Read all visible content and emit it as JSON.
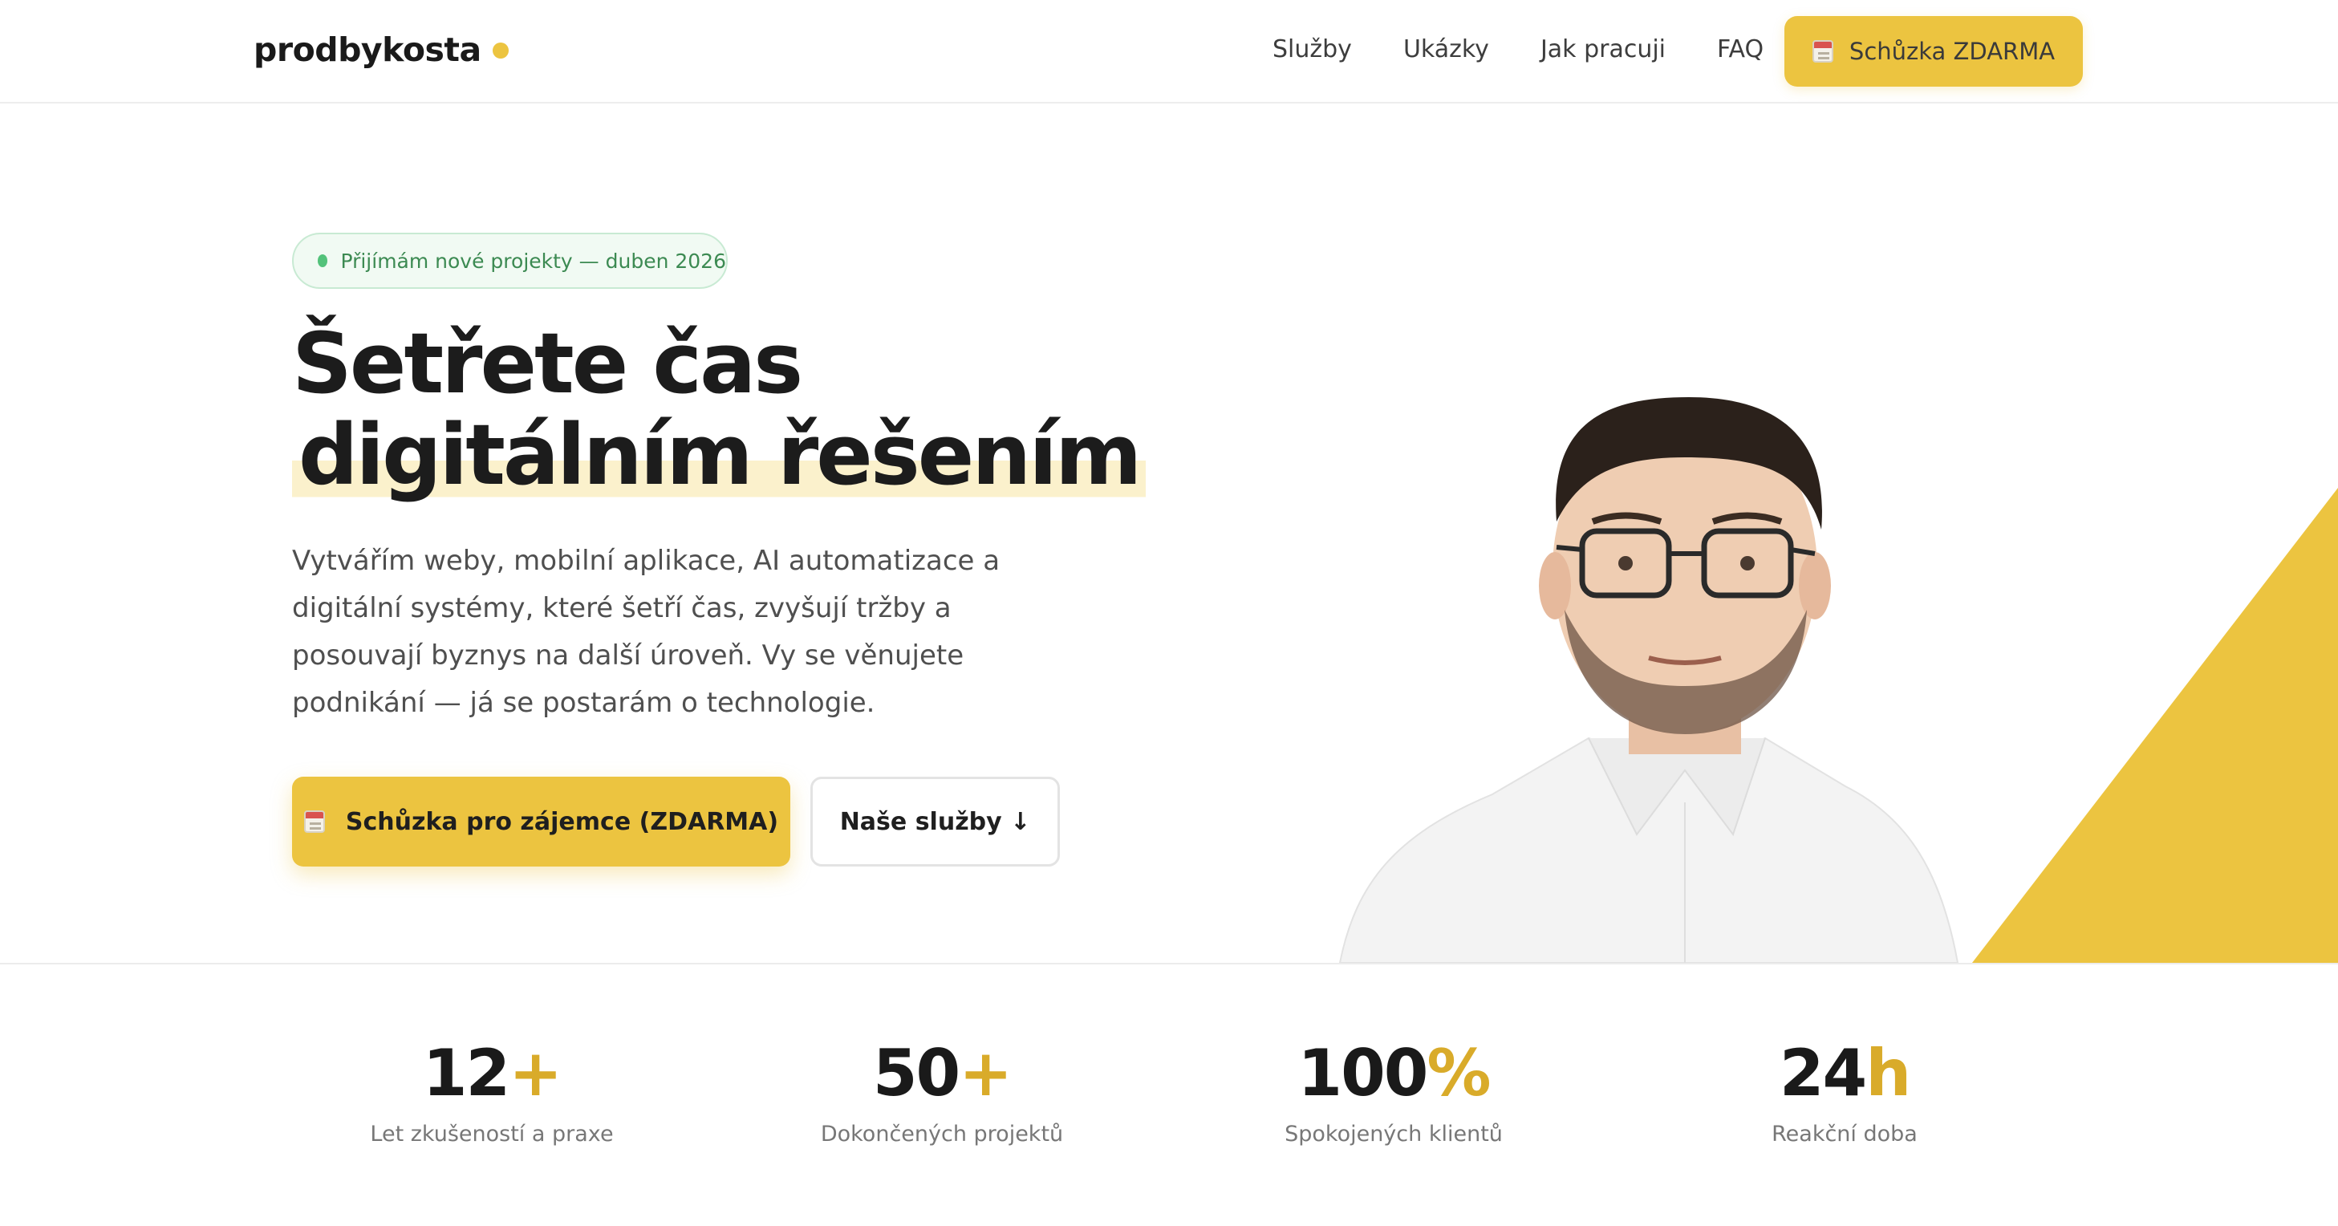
{
  "brand": {
    "name": "prodbykosta",
    "dot_color": "#ecc440"
  },
  "nav": {
    "items": [
      "Služby",
      "Ukázky",
      "Jak pracuji",
      "FAQ"
    ],
    "cta_label": "Schůzka ZDARMA",
    "cta_icon": "calendar-icon"
  },
  "hero": {
    "badge": "Přijímám nové projekty — duben 2026",
    "title_line1": "Šetřete čas",
    "title_line2": "digitálním řešením",
    "description": "Vytvářím weby, mobilní aplikace, AI automatizace a digitální systémy, které šetří čas, zvyšují tržby a posouvají byznys na další úroveň. Vy se věnujete podnikání — já se postarám o technologie.",
    "primary_button": "Schůzka pro zájemce (ZDARMA)",
    "secondary_button": "Naše služby ↓"
  },
  "stats": [
    {
      "value": "12",
      "suffix": "+",
      "label": "Let zkušeností a praxe"
    },
    {
      "value": "50",
      "suffix": "+",
      "label": "Dokončených projektů"
    },
    {
      "value": "100",
      "suffix": "%",
      "label": "Spokojených klientů"
    },
    {
      "value": "24",
      "suffix": "h",
      "label": "Reakční doba"
    }
  ],
  "colors": {
    "accent": "#ecc440",
    "accent_text": "#d9ab2a",
    "badge_green": "#3c8a52"
  }
}
